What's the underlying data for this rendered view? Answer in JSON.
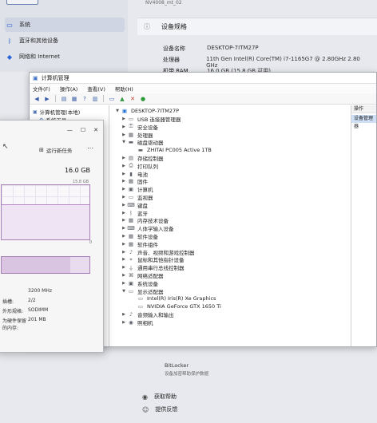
{
  "settings": {
    "nav_items": [
      {
        "label": "系统",
        "icon": "monitor-icon"
      },
      {
        "label": "蓝牙和其他设备",
        "icon": "bluetooth-icon"
      },
      {
        "label": "网络和 Internet",
        "icon": "wifi-icon"
      }
    ],
    "device_name_small": "NV4008_mt_02",
    "spec_header": "设备规格",
    "specs": [
      {
        "key": "设备名称",
        "value": "DESKTOP-7ITM27P"
      },
      {
        "key": "处理器",
        "value": "11th Gen Intel(R) Core(TM) i7-1165G7 @ 2.80GHz   2.80 GHz"
      },
      {
        "key": "机带 RAM",
        "value": "16.0 GB (15.8 GB 可用)"
      }
    ],
    "bottom_items": [
      {
        "label": "获取帮助",
        "icon": "help-icon"
      },
      {
        "label": "提供反馈",
        "icon": "feedback-icon"
      }
    ],
    "bitlocker": {
      "title": "BitLocker",
      "subtitle": "设备加密帮助保护数据"
    }
  },
  "device_manager": {
    "title": "计算机管理",
    "menu": [
      "文件(F)",
      "操作(A)",
      "查看(V)",
      "帮助(H)"
    ],
    "left_tree": [
      {
        "label": "计算机管理(本地)",
        "icon": "computer-icon"
      },
      {
        "label": "系统工具",
        "icon": "tools-icon"
      }
    ],
    "root": "DESKTOP-7ITM27P",
    "tree": [
      {
        "label": "USB 连接器管理器",
        "expanded": false,
        "indent": 1
      },
      {
        "label": "安全设备",
        "expanded": false,
        "indent": 1
      },
      {
        "label": "处理器",
        "expanded": false,
        "indent": 1
      },
      {
        "label": "磁盘驱动器",
        "expanded": true,
        "indent": 1
      },
      {
        "label": "ZHITAI PC005 Active 1TB",
        "expanded": null,
        "indent": 2
      },
      {
        "label": "存储控制器",
        "expanded": false,
        "indent": 1
      },
      {
        "label": "打印队列",
        "expanded": false,
        "indent": 1
      },
      {
        "label": "电池",
        "expanded": false,
        "indent": 1
      },
      {
        "label": "固件",
        "expanded": false,
        "indent": 1
      },
      {
        "label": "计算机",
        "expanded": false,
        "indent": 1
      },
      {
        "label": "监视器",
        "expanded": false,
        "indent": 1
      },
      {
        "label": "键盘",
        "expanded": false,
        "indent": 1
      },
      {
        "label": "蓝牙",
        "expanded": false,
        "indent": 1
      },
      {
        "label": "内存技术设备",
        "expanded": false,
        "indent": 1
      },
      {
        "label": "人体学输入设备",
        "expanded": false,
        "indent": 1
      },
      {
        "label": "软件设备",
        "expanded": false,
        "indent": 1
      },
      {
        "label": "软件组件",
        "expanded": false,
        "indent": 1
      },
      {
        "label": "声音、视频和游戏控制器",
        "expanded": false,
        "indent": 1
      },
      {
        "label": "鼠标和其他指针设备",
        "expanded": false,
        "indent": 1
      },
      {
        "label": "通用串行总线控制器",
        "expanded": false,
        "indent": 1
      },
      {
        "label": "网络适配器",
        "expanded": false,
        "indent": 1
      },
      {
        "label": "系统设备",
        "expanded": false,
        "indent": 1
      },
      {
        "label": "显示适配器",
        "expanded": true,
        "indent": 1
      },
      {
        "label": "Intel(R) Iris(R) Xe Graphics",
        "expanded": null,
        "indent": 2
      },
      {
        "label": "NVIDIA GeForce GTX 1650 Ti",
        "expanded": null,
        "indent": 2
      },
      {
        "label": "音频输入和输出",
        "expanded": false,
        "indent": 1
      },
      {
        "label": "照相机",
        "expanded": false,
        "indent": 1
      }
    ],
    "actions": {
      "header": "操作",
      "item": "设备管理器"
    }
  },
  "task_manager": {
    "new_task": "运行新任务",
    "capacity": "16.0 GB",
    "used": "15.8 GB",
    "zero": "0",
    "stats": [
      {
        "key": "",
        "value": "3200 MHz"
      },
      {
        "key": "插槽:",
        "value": "2/2"
      },
      {
        "key": "外形规格:",
        "value": "SODIMM"
      },
      {
        "key": "为硬件保留的内存:",
        "value": "201 MB"
      }
    ]
  }
}
